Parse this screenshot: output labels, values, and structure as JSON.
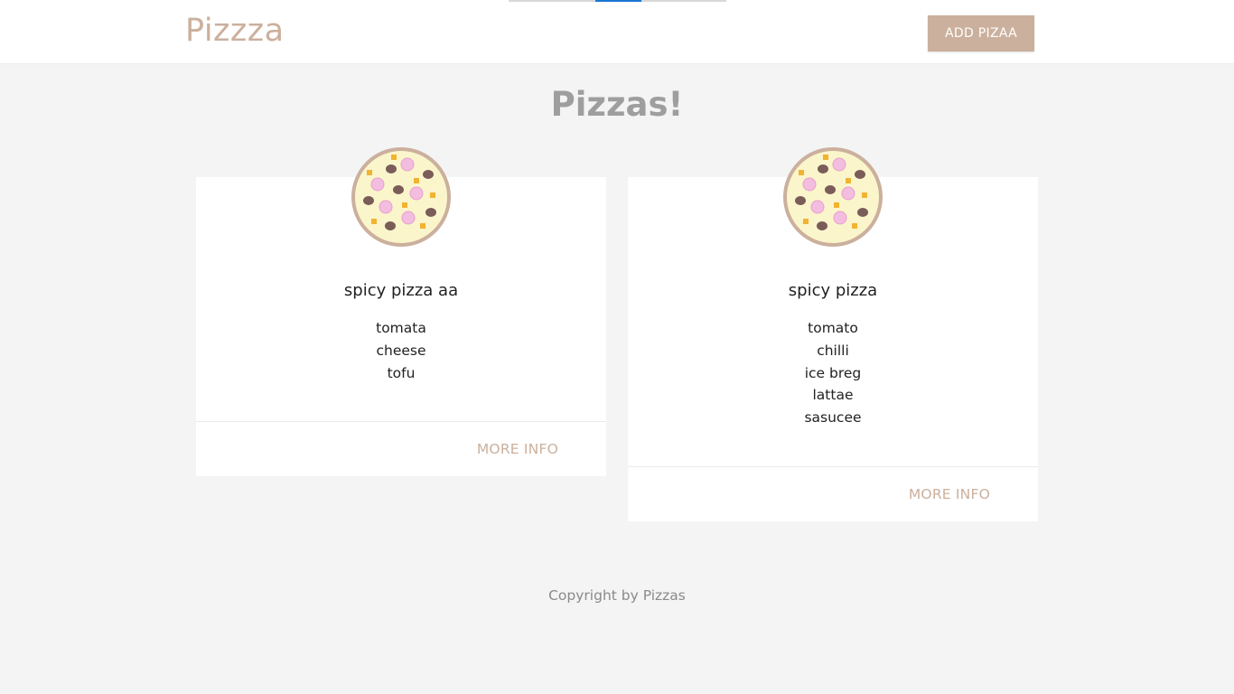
{
  "header": {
    "brand": "Pizzza",
    "add_button_label": "ADD PIZAA"
  },
  "main": {
    "heading": "Pizzas!"
  },
  "pizzas": [
    {
      "title": "spicy pizza aa",
      "ingredients": [
        "tomata",
        "cheese",
        "tofu"
      ],
      "action_label": "MORE INFO",
      "icon": "pizza-icon"
    },
    {
      "title": "spicy pizza",
      "ingredients": [
        "tomato",
        "chilli",
        "ice breg",
        "lattae",
        "sasucee"
      ],
      "action_label": "MORE INFO",
      "icon": "pizza-icon"
    }
  ],
  "footer": {
    "text": "Copyright by Pizzas"
  },
  "colors": {
    "accent": "#cbb09d",
    "background": "#f4f4f4",
    "progress": "#1976d2"
  }
}
